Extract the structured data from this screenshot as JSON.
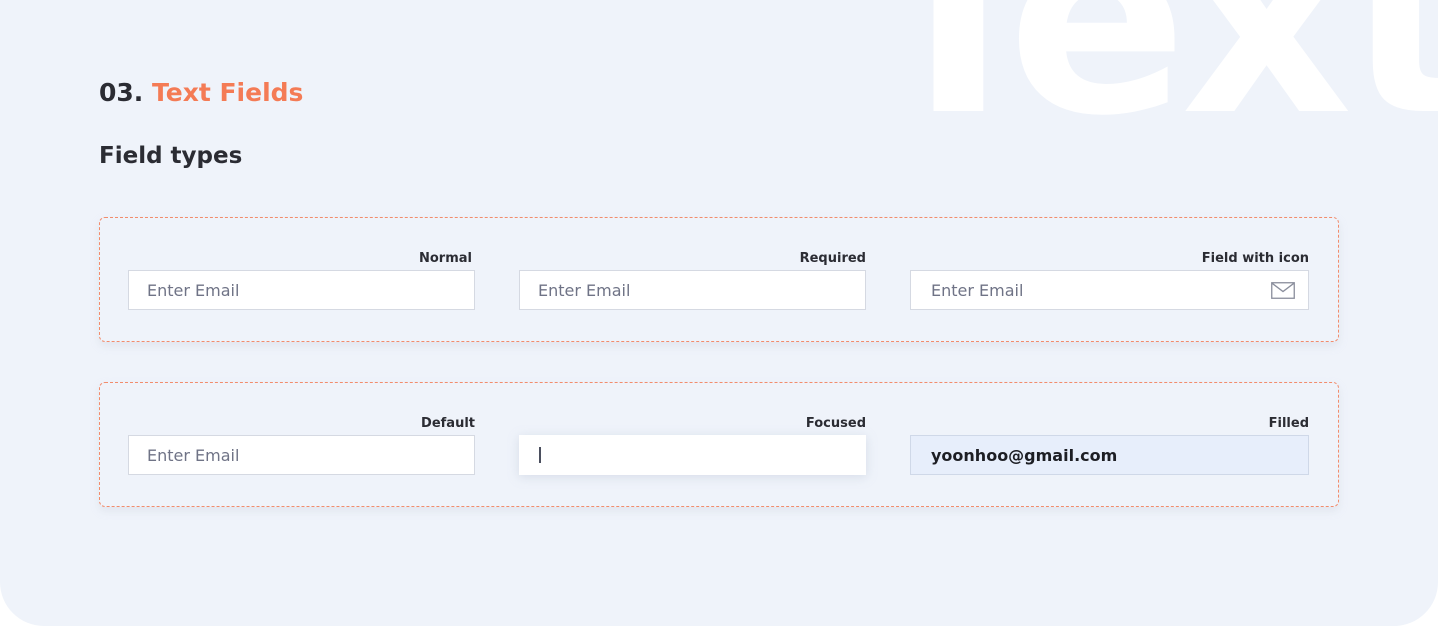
{
  "watermark": "Text",
  "section": {
    "number": "03.",
    "title": "Text Fields"
  },
  "subheading": "Field types",
  "group1": {
    "fields": [
      {
        "label": "Normal",
        "placeholder": "Enter Email"
      },
      {
        "label": "Required",
        "placeholder": "Enter Email"
      },
      {
        "label": "Field with icon",
        "placeholder": "Enter Email",
        "icon": "mail-icon"
      }
    ]
  },
  "group2": {
    "fields": [
      {
        "label": "Default",
        "placeholder": "Enter Email"
      },
      {
        "label": "Focused",
        "placeholder": ""
      },
      {
        "label": "Filled",
        "value": "yoonhoo@gmail.com"
      }
    ]
  },
  "colors": {
    "background": "#eff3fa",
    "accent": "#f47b55",
    "dashed_border": "#f28c6c",
    "filled_field_bg": "#e7eefb"
  }
}
